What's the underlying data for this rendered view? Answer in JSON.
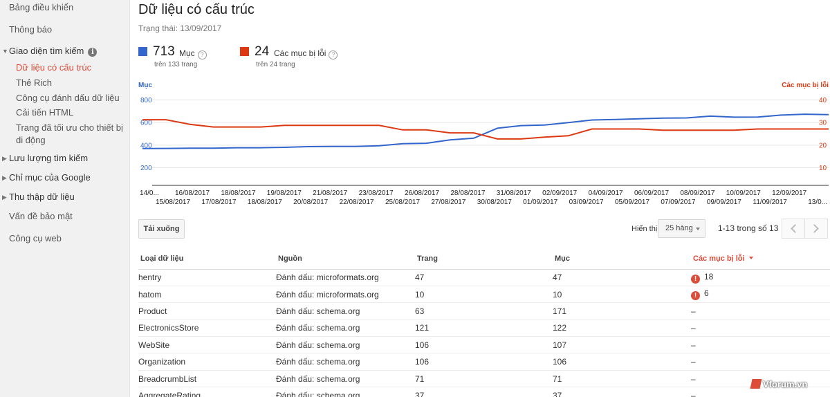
{
  "sidebar": {
    "items": [
      {
        "label": "Bảng điều khiển"
      },
      {
        "label": "Thông báo"
      },
      {
        "label": "Giao diện tìm kiếm"
      },
      {
        "label": "Dữ liệu có cấu trúc"
      },
      {
        "label": "Thẻ Rich"
      },
      {
        "label": "Công cụ đánh dấu dữ liệu"
      },
      {
        "label": "Cải tiến HTML"
      },
      {
        "label": "Trang đã tối ưu cho thiết bị"
      },
      {
        "label": "di động"
      },
      {
        "label": "Lưu lượng tìm kiếm"
      },
      {
        "label": "Chỉ mục của Google"
      },
      {
        "label": "Thu thập dữ liệu"
      },
      {
        "label": "Vấn đề bảo mật"
      },
      {
        "label": "Công cụ web"
      }
    ],
    "info_glyph": "i"
  },
  "header": {
    "title": "Dữ liệu có cấu trúc",
    "status": "Trạng thái: 13/09/2017"
  },
  "metrics": {
    "items": {
      "value": "713",
      "label": "Mục",
      "sub": "trên 133 trang",
      "color": "#3366cc"
    },
    "errors": {
      "value": "24",
      "label": "Các mục bị lỗi",
      "sub": "trên 24 trang",
      "color": "#dc3912"
    },
    "help_glyph": "?"
  },
  "chart_data": {
    "type": "line",
    "left_axis_title": "Mục",
    "right_axis_title": "Các mục bị lỗi",
    "left_ticks": [
      200,
      400,
      600,
      800
    ],
    "right_ticks": [
      10,
      20,
      30,
      40
    ],
    "x_top_labels": [
      "14/0...",
      "16/08/2017",
      "18/08/2017",
      "19/08/2017",
      "21/08/2017",
      "23/08/2017",
      "26/08/2017",
      "28/08/2017",
      "31/08/2017",
      "02/09/2017",
      "04/09/2017",
      "06/09/2017",
      "08/09/2017",
      "10/09/2017",
      "12/09/2017"
    ],
    "x_bottom_labels": [
      "15/08/2017",
      "17/08/2017",
      "18/08/2017",
      "20/08/2017",
      "22/08/2017",
      "25/08/2017",
      "27/08/2017",
      "30/08/2017",
      "01/09/2017",
      "03/09/2017",
      "05/09/2017",
      "07/09/2017",
      "09/09/2017",
      "11/09/2017",
      "13/0..."
    ],
    "series": [
      {
        "name": "Mục",
        "color": "#3366cc",
        "axis": "left",
        "values": [
          385,
          386,
          388,
          388,
          392,
          392,
          396,
          402,
          403,
          404,
          410,
          428,
          432,
          462,
          477,
          565,
          588,
          593,
          615,
          638,
          642,
          648,
          654,
          656,
          672,
          663,
          664,
          681,
          689,
          685
        ]
      },
      {
        "name": "Các mục bị lỗi",
        "color": "#dc3912",
        "axis": "right",
        "values": [
          32,
          32,
          30,
          28.8,
          28.8,
          28.8,
          29.5,
          29.5,
          29.5,
          29.5,
          29.5,
          27.5,
          27.5,
          26.2,
          26.2,
          23.5,
          23.5,
          24.3,
          24.9,
          27.9,
          27.9,
          27.9,
          27.4,
          27.4,
          27.4,
          27.4,
          27.9,
          27.9,
          27.9,
          27.9
        ]
      }
    ]
  },
  "toolbar": {
    "download_label": "Tải xuống",
    "show_label": "Hiển thị",
    "rows_value": "25 hàng",
    "range_text": "1-13 trong số 13"
  },
  "table": {
    "columns": [
      "Loại dữ liệu",
      "Nguồn",
      "Trang",
      "Mục",
      "Các mục bị lỗi"
    ],
    "rows": [
      [
        "hentry",
        "Đánh dấu: microformats.org",
        "47",
        "47",
        "18"
      ],
      [
        "hatom",
        "Đánh dấu: microformats.org",
        "10",
        "10",
        "6"
      ],
      [
        "Product",
        "Đánh dấu: schema.org",
        "63",
        "171",
        "–"
      ],
      [
        "ElectronicsStore",
        "Đánh dấu: schema.org",
        "121",
        "122",
        "–"
      ],
      [
        "WebSite",
        "Đánh dấu: schema.org",
        "106",
        "107",
        "–"
      ],
      [
        "Organization",
        "Đánh dấu: schema.org",
        "106",
        "106",
        "–"
      ],
      [
        "BreadcrumbList",
        "Đánh dấu: schema.org",
        "71",
        "71",
        "–"
      ],
      [
        "AggregateRating",
        "Đánh dấu: schema.org",
        "37",
        "37",
        "–"
      ]
    ],
    "error_glyph": "!"
  },
  "watermark": "Vforum.vn"
}
